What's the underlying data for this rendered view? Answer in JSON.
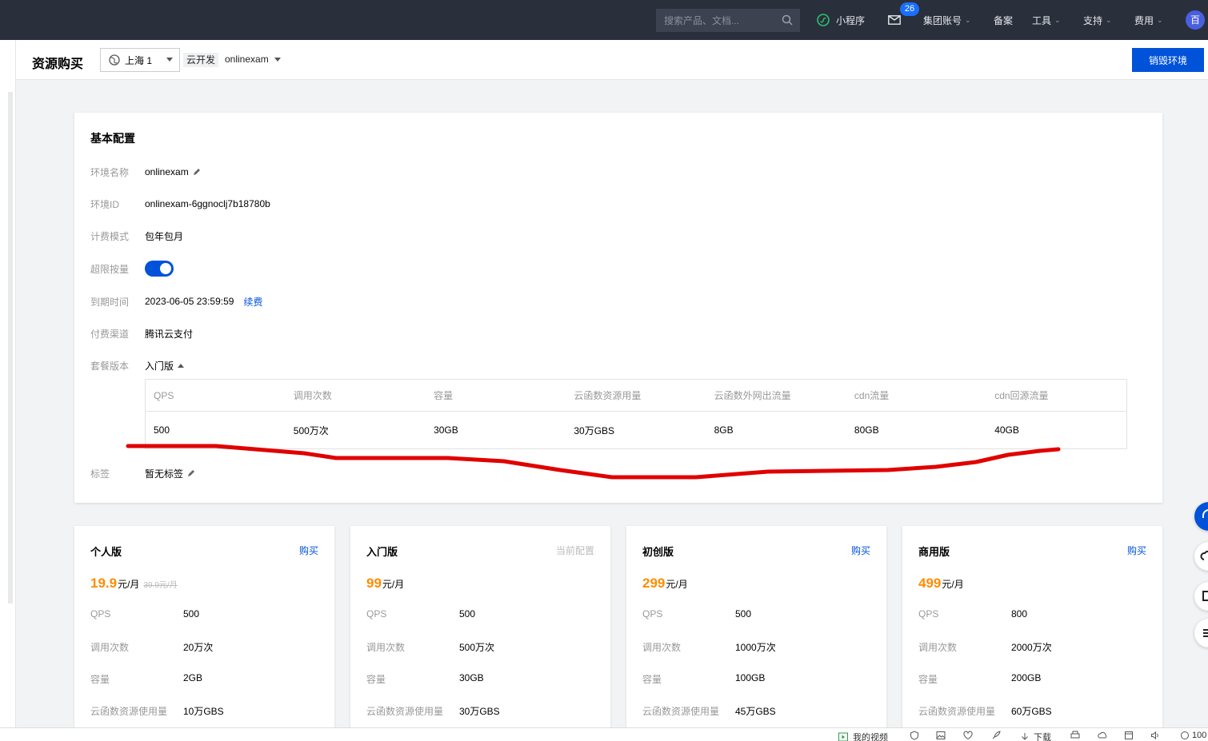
{
  "topnav": {
    "search_placeholder": "搜索产品、文档...",
    "mini_program": "小程序",
    "mail_count": "26",
    "group_account": "集团账号",
    "record": "备案",
    "tools": "工具",
    "support": "支持",
    "billing": "费用",
    "avatar": "百"
  },
  "subheader": {
    "title": "资源购买",
    "region": "上海 1",
    "env_tag": "云开发",
    "env_name": "onlinexam",
    "destroy_button": "销毁环境"
  },
  "config": {
    "title": "基本配置",
    "rows": {
      "env_name": {
        "label": "环境名称",
        "value": "onlinexam"
      },
      "env_id": {
        "label": "环境ID",
        "value": "onlinexam-6ggnoclj7b18780b"
      },
      "billing_mode": {
        "label": "计费模式",
        "value": "包年包月"
      },
      "overage": {
        "label": "超限按量",
        "enabled": true
      },
      "expiry": {
        "label": "到期时间",
        "value": "2023-06-05 23:59:59",
        "renew": "续费"
      },
      "payment": {
        "label": "付费渠道",
        "value": "腾讯云支付"
      },
      "package": {
        "label": "套餐版本",
        "value": "入门版"
      },
      "tags": {
        "label": "标签",
        "value": "暂无标签"
      }
    },
    "spec_table": {
      "headers": [
        "QPS",
        "调用次数",
        "容量",
        "云函数资源用量",
        "云函数外网出流量",
        "cdn流量",
        "cdn回源流量"
      ],
      "values": [
        "500",
        "500万次",
        "30GB",
        "30万GBS",
        "8GB",
        "80GB",
        "40GB"
      ]
    }
  },
  "plans": [
    {
      "name": "个人版",
      "action": "购买",
      "price": "19.9",
      "unit": "元/月",
      "old_price": "39.9元/月",
      "qps": "500",
      "calls": "20万次",
      "capacity": "2GB",
      "gbs": "10万GBS"
    },
    {
      "name": "入门版",
      "action": "当前配置",
      "price": "99",
      "unit": "元/月",
      "old_price": "",
      "qps": "500",
      "calls": "500万次",
      "capacity": "30GB",
      "gbs": "30万GBS"
    },
    {
      "name": "初创版",
      "action": "购买",
      "price": "299",
      "unit": "元/月",
      "old_price": "",
      "qps": "500",
      "calls": "1000万次",
      "capacity": "100GB",
      "gbs": "45万GBS"
    },
    {
      "name": "商用版",
      "action": "购买",
      "price": "499",
      "unit": "元/月",
      "old_price": "",
      "qps": "800",
      "calls": "2000万次",
      "capacity": "200GB",
      "gbs": "60万GBS"
    }
  ],
  "plan_labels": {
    "qps": "QPS",
    "calls": "调用次数",
    "capacity": "容量",
    "gbs": "云函数资源使用量"
  },
  "bottombar": {
    "my_video": "我的视频",
    "download": "下载",
    "zoom": "100"
  },
  "colors": {
    "primary": "#0052d9",
    "price": "#ff8c00",
    "nav_bg": "#2a2f3c",
    "annotation": "#e00000"
  }
}
